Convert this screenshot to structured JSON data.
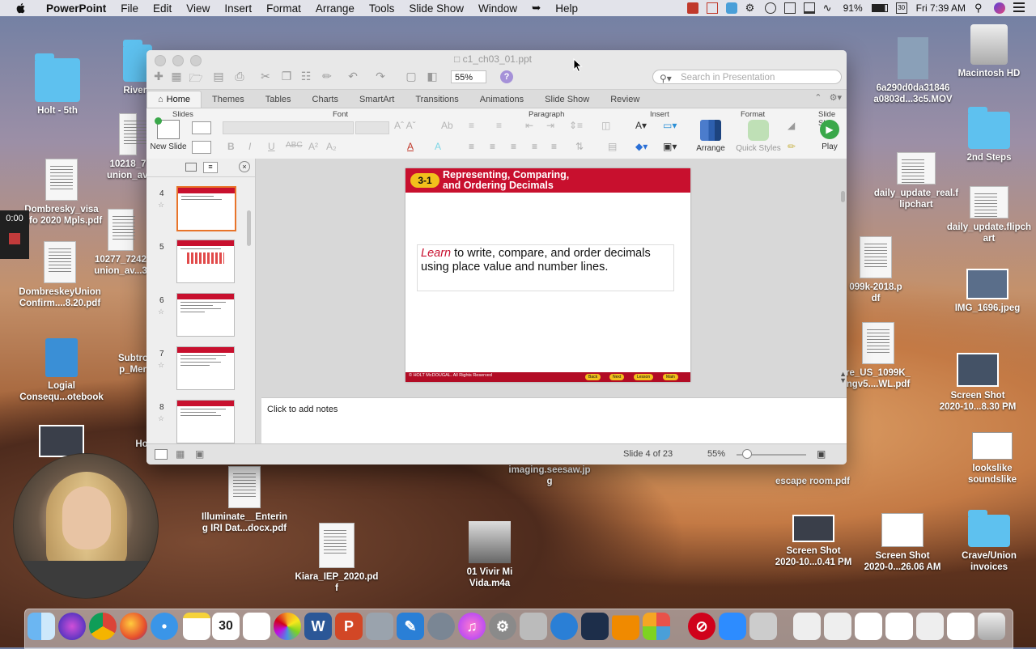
{
  "menubar": {
    "app": "PowerPoint",
    "menus": [
      "File",
      "Edit",
      "View",
      "Insert",
      "Format",
      "Arrange",
      "Tools",
      "Slide Show",
      "Window",
      "Help"
    ],
    "battery": "91%",
    "clock": "Fri 7:39 AM"
  },
  "desktop_left": [
    {
      "label": "Holt - 5th"
    },
    {
      "label": "Rivers"
    },
    {
      "label": "10218_7\nunion_av..."
    },
    {
      "label": "Dombresky_visa\ninfo 2020 Mpls.pdf"
    },
    {
      "label": "10277_7242\nunion_av...3"
    },
    {
      "label": "DombreskeyUnion\nConfirm....8.20.pdf"
    },
    {
      "label": "Logial\nConsequ...otebook"
    },
    {
      "label": "Subtro\np_Mer"
    },
    {
      "label": "Ho"
    }
  ],
  "desktop_bottom": [
    {
      "label": "Illuminate__Enterin\ng IRI Dat...docx.pdf"
    },
    {
      "label": "imaging.seesaw.jp\ng"
    },
    {
      "label": "Kiara_IEP_2020.pd\nf"
    },
    {
      "label": "01 Vivir Mi\nVida.m4a"
    }
  ],
  "desktop_right": [
    {
      "label": "6a290d0da31846\na0803d...3c5.MOV"
    },
    {
      "label": "Macintosh HD"
    },
    {
      "label": "2nd Steps"
    },
    {
      "label": "daily_update_real.f\nlipchart"
    },
    {
      "label": "daily_update.flipch\nart"
    },
    {
      "label": "099k-2018.p\ndf"
    },
    {
      "label": "IMG_1696.jpeg"
    },
    {
      "label": "re_US_1099K_\nngv5....WL.pdf"
    },
    {
      "label": "Screen Shot\n2020-10...8.30 PM"
    },
    {
      "label": "lookslike\nsoundslike"
    },
    {
      "label": "escape room.pdf"
    },
    {
      "label": "Screen Shot\n2020-10...0.41 PM"
    },
    {
      "label": "Screen Shot\n2020-0...26.06 AM"
    },
    {
      "label": "Crave/Union\ninvoices"
    }
  ],
  "window": {
    "title": "c1_ch03_01.ppt",
    "zoom": "55%",
    "search_placeholder": "Search in Presentation",
    "tabs": [
      "Home",
      "Themes",
      "Tables",
      "Charts",
      "SmartArt",
      "Transitions",
      "Animations",
      "Slide Show",
      "Review"
    ],
    "groups": {
      "slides": "Slides",
      "font": "Font",
      "paragraph": "Paragraph",
      "insert": "Insert",
      "format": "Format",
      "slideshow": "Slide Sh"
    },
    "buttons": {
      "new_slide": "New Slide",
      "arrange": "Arrange",
      "quick_styles": "Quick Styles",
      "play": "Play"
    },
    "thumbnails": [
      {
        "num": "4"
      },
      {
        "num": "5"
      },
      {
        "num": "6"
      },
      {
        "num": "7"
      },
      {
        "num": "8"
      }
    ],
    "slide": {
      "badge": "3-1",
      "title_line1": "Representing, Comparing,",
      "title_line2": "and Ordering Decimals",
      "body_emph": "Learn",
      "body_rest": " to write, compare, and order decimals using place value and number lines.",
      "footer": "© HOLT McDOUGAL. All Rights Reserved",
      "nav": [
        "Back",
        "Next",
        "Lesson",
        "Main"
      ]
    },
    "notes_placeholder": "Click to add notes",
    "status_slide": "Slide 4 of 23",
    "status_zoom": "55%"
  },
  "recording": {
    "time": "0:00"
  }
}
